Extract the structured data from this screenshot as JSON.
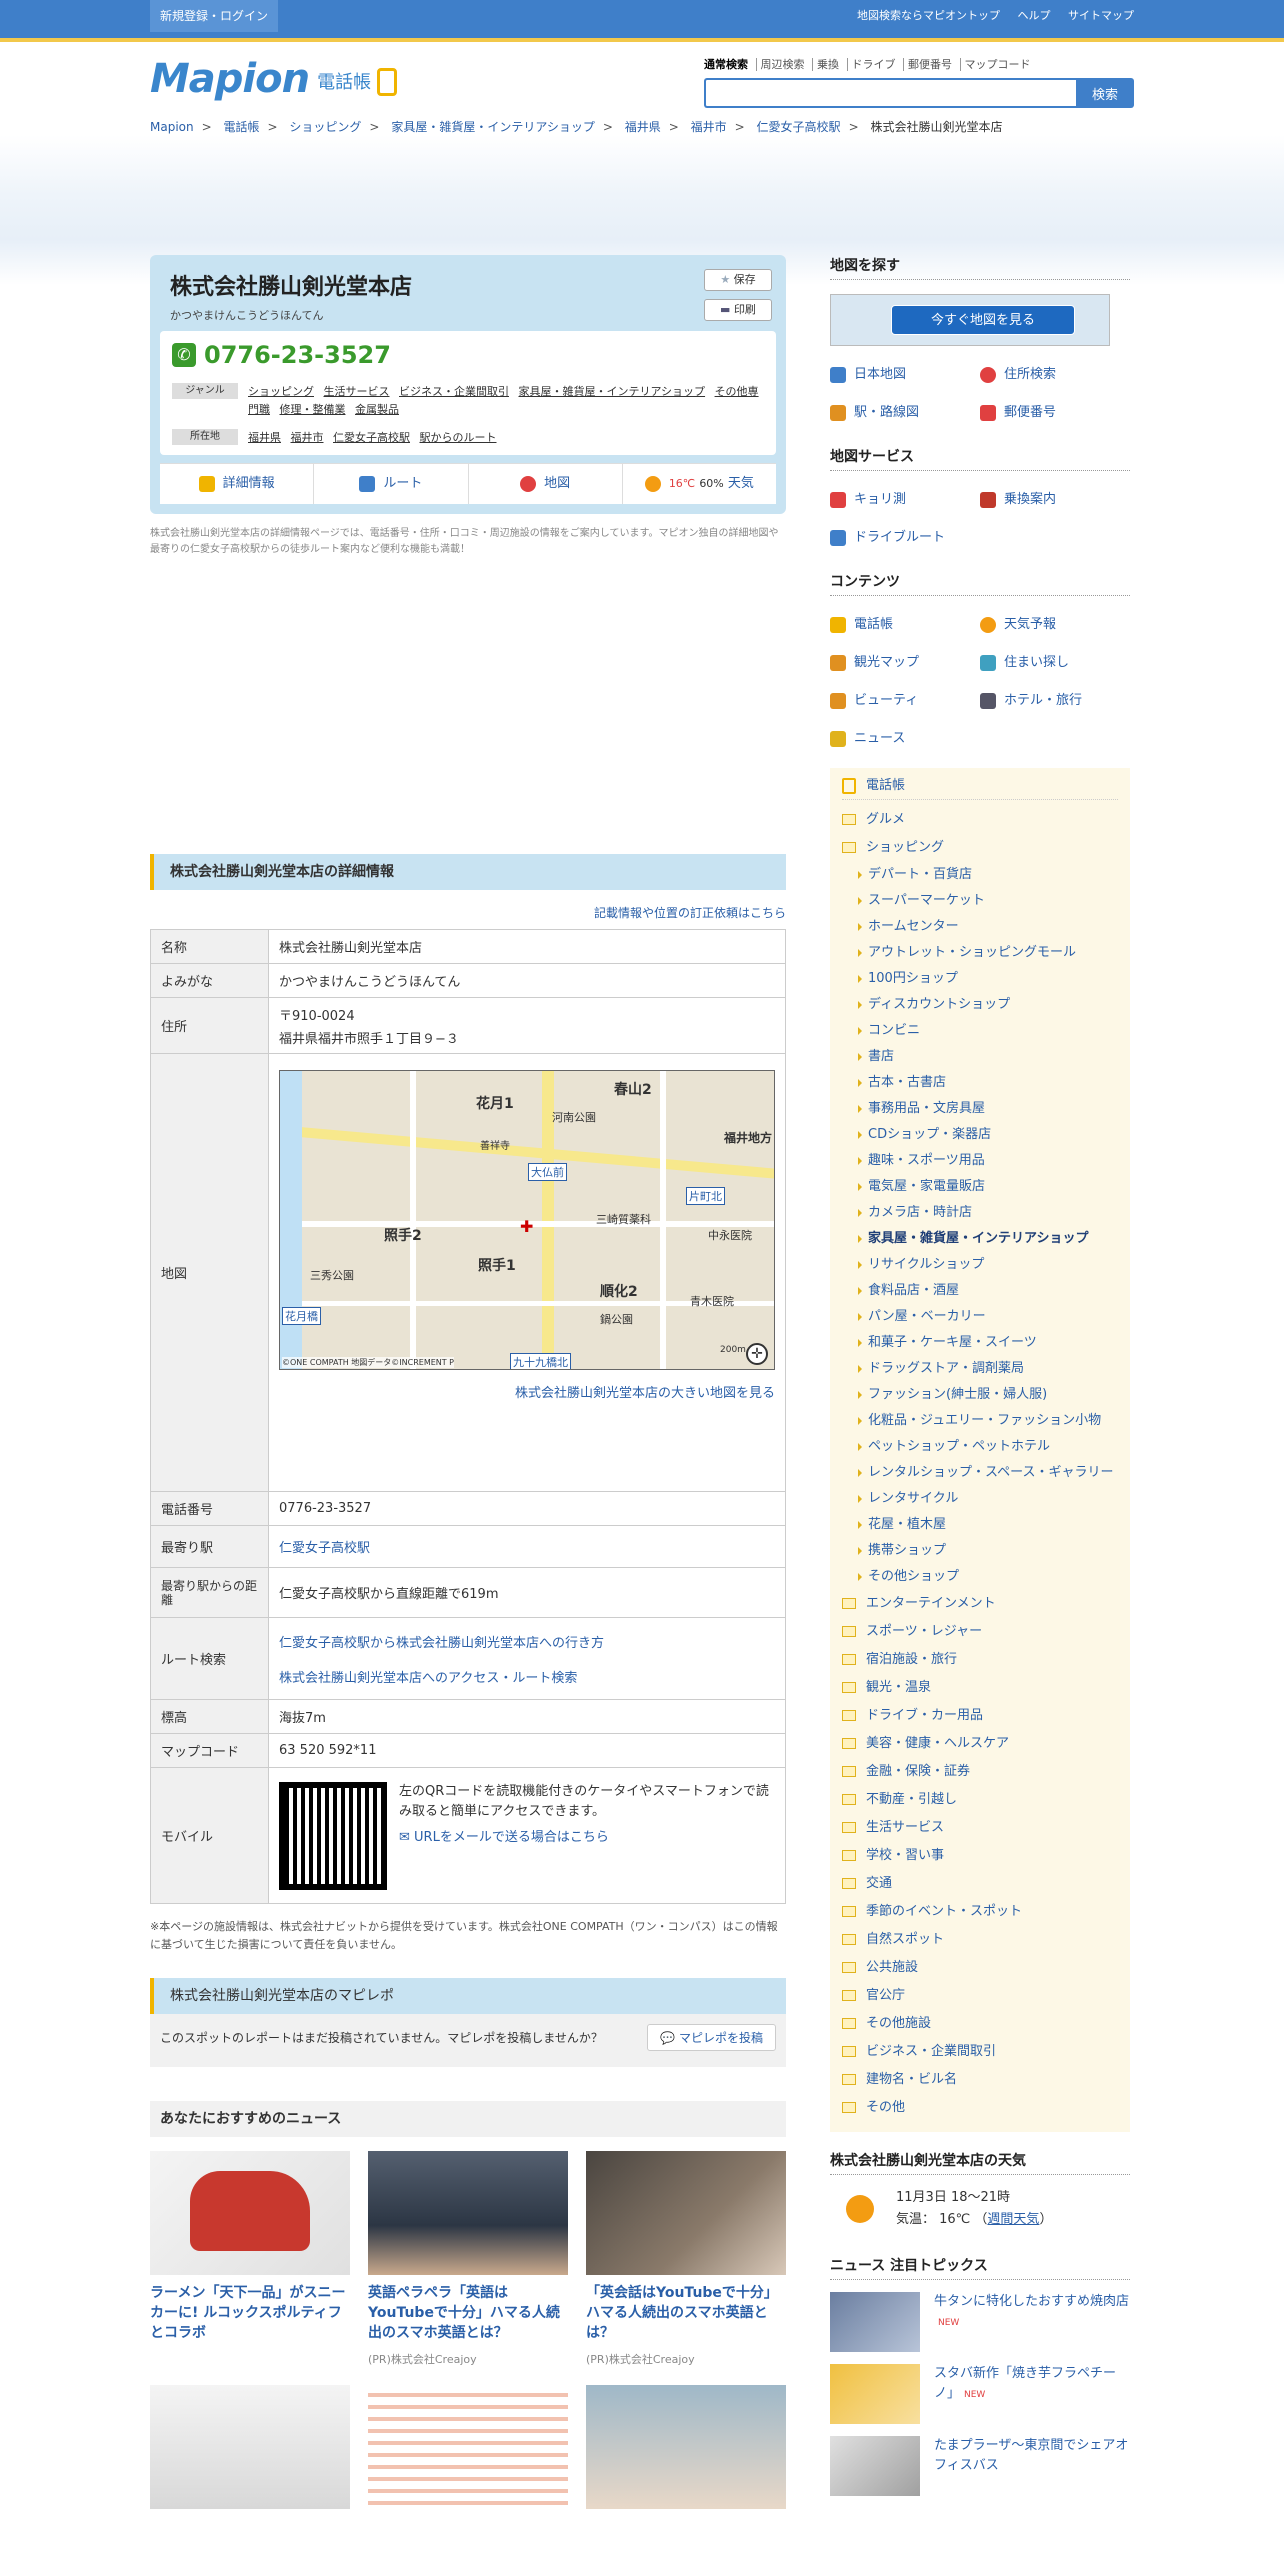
{
  "topbar": {
    "login": "新規登録・ログイン",
    "links": [
      "地図検索ならマピオントップ",
      "ヘルプ",
      "サイトマップ"
    ]
  },
  "logo": {
    "mark": "Mapion",
    "sub": "電話帳"
  },
  "search": {
    "tabs": [
      "通常検索",
      "周辺検索",
      "乗換",
      "ドライブ",
      "郵便番号",
      "マップコード"
    ],
    "button": "検索",
    "placeholder": ""
  },
  "breadcrumb": [
    "Mapion",
    "電話帳",
    "ショッピング",
    "家具屋・雑貨屋・インテリアショップ",
    "福井県",
    "福井市",
    "仁愛女子高校駅",
    "株式会社勝山剣光堂本店"
  ],
  "shop": {
    "name": "株式会社勝山剣光堂本店",
    "kana": "かつやまけんこうどうほんてん",
    "save": "保存",
    "print": "印刷",
    "tel": "0776-23-3527",
    "genre_label": "ジャンル",
    "genres": [
      "ショッピング",
      "生活サービス",
      "ビジネス・企業間取引",
      "家具屋・雑貨屋・インテリアショップ",
      "その他専門職",
      "修理・整備業",
      "金属製品"
    ],
    "loc_label": "所在地",
    "locs": [
      "福井県",
      "福井市",
      "仁愛女子高校駅",
      "駅からのルート"
    ],
    "nav": [
      "詳細情報",
      "ルート",
      "地図"
    ],
    "weather_temp": "16℃",
    "weather_pct": "60%",
    "weather_label": "天気",
    "desc": "株式会社勝山剣光堂本店の詳細情報ページでは、電話番号・住所・口コミ・周辺施設の情報をご案内しています。マピオン独自の詳細地図や最寄りの仁愛女子高校駅からの徒歩ルート案内など便利な機能も満載！"
  },
  "detail": {
    "heading": "株式会社勝山剣光堂本店の詳細情報",
    "fix_link": "記載情報や位置の訂正依頼はこちら",
    "rows": {
      "name_l": "名称",
      "name_v": "株式会社勝山剣光堂本店",
      "kana_l": "よみがな",
      "kana_v": "かつやまけんこうどうほんてん",
      "addr_l": "住所",
      "addr_zip": "〒910-0024",
      "addr_v": "福井県福井市照手１丁目９−３",
      "map_l": "地図",
      "map_link": "株式会社勝山剣光堂本店の大きい地図を見る",
      "tel_l": "電話番号",
      "tel_v": "0776-23-3527",
      "station_l": "最寄り駅",
      "station_v": "仁愛女子高校駅",
      "dist_l": "最寄り駅からの距離",
      "dist_v": "仁愛女子高校駅から直線距離で619m",
      "route_l": "ルート検索",
      "route_1": "仁愛女子高校駅から株式会社勝山剣光堂本店への行き方",
      "route_2": "株式会社勝山剣光堂本店へのアクセス・ルート検索",
      "alt_l": "標高",
      "alt_v": "海抜7m",
      "code_l": "マップコード",
      "code_v": "63 520 592*11",
      "mobile_l": "モバイル",
      "mobile_v": "左のQRコードを読取機能付きのケータイやスマートフォンで読み取ると簡単にアクセスできます。",
      "mobile_link": "URLをメールで送る場合はこちら"
    },
    "map_labels": [
      "春山2",
      "花月1",
      "河南公園",
      "福井地方",
      "大仏前",
      "片町北",
      "照手2",
      "照手1",
      "三秀公園",
      "三崎質薬科",
      "中永医院",
      "順化2",
      "青木医院",
      "鍋公園",
      "花月橋",
      "九十九橋北",
      "善祥寺",
      "200m",
      "©ONE COMPATH 地図データ©INCREMENT P"
    ],
    "note": "※本ページの施設情報は、株式会社ナビットから提供を受けています。株式会社ONE COMPATH（ワン・コンパス）はこの情報に基づいて生じた損害について責任を負いません。"
  },
  "mapirepo": {
    "heading": "株式会社勝山剣光堂本店のマピレポ",
    "text": "このスポットのレポートはまだ投稿されていません。マピレポを投稿しませんか？",
    "button": "マピレポを投稿"
  },
  "news": {
    "heading": "あなたにおすすめのニュース",
    "items": [
      {
        "title": "ラーメン「天下一品」がスニーカーに! ルコックスポルティフとコラボ",
        "pr": ""
      },
      {
        "title": "英語ペラペラ「英語はYouTubeで十分」ハマる人続出のスマホ英語とは？",
        "pr": "(PR)株式会社Creajoy"
      },
      {
        "title": "「英会話はYouTubeで十分」ハマる人続出のスマホ英語とは？",
        "pr": "(PR)株式会社Creajoy"
      }
    ]
  },
  "right": {
    "find_head": "地図を探す",
    "banner": "今すぐ地図を見る",
    "find": [
      "日本地図",
      "住所検索",
      "駅・路線図",
      "郵便番号"
    ],
    "service_head": "地図サービス",
    "service": [
      "キョリ測",
      "乗換案内",
      "ドライブルート"
    ],
    "content_head": "コンテンツ",
    "content": [
      "電話帳",
      "天気予報",
      "観光マップ",
      "住まい探し",
      "ビューティ",
      "ホテル・旅行",
      "ニュース"
    ],
    "cat_top": "電話帳",
    "cats": [
      {
        "t": "グルメ",
        "k": "f"
      },
      {
        "t": "ショッピング",
        "k": "f"
      },
      {
        "t": "デパート・百貨店",
        "k": "s"
      },
      {
        "t": "スーパーマーケット",
        "k": "s"
      },
      {
        "t": "ホームセンター",
        "k": "s"
      },
      {
        "t": "アウトレット・ショッピングモール",
        "k": "s"
      },
      {
        "t": "100円ショップ",
        "k": "s"
      },
      {
        "t": "ディスカウントショップ",
        "k": "s"
      },
      {
        "t": "コンビニ",
        "k": "s"
      },
      {
        "t": "書店",
        "k": "s"
      },
      {
        "t": "古本・古書店",
        "k": "s"
      },
      {
        "t": "事務用品・文房具屋",
        "k": "s"
      },
      {
        "t": "CDショップ・楽器店",
        "k": "s"
      },
      {
        "t": "趣味・スポーツ用品",
        "k": "s"
      },
      {
        "t": "電気屋・家電量販店",
        "k": "s"
      },
      {
        "t": "カメラ店・時計店",
        "k": "s"
      },
      {
        "t": "家具屋・雑貨屋・インテリアショップ",
        "k": "b"
      },
      {
        "t": "リサイクルショップ",
        "k": "s"
      },
      {
        "t": "食料品店・酒屋",
        "k": "s"
      },
      {
        "t": "パン屋・ベーカリー",
        "k": "s"
      },
      {
        "t": "和菓子・ケーキ屋・スイーツ",
        "k": "s"
      },
      {
        "t": "ドラッグストア・調剤薬局",
        "k": "s"
      },
      {
        "t": "ファッション(紳士服・婦人服)",
        "k": "s"
      },
      {
        "t": "化粧品・ジュエリー・ファッション小物",
        "k": "s"
      },
      {
        "t": "ペットショップ・ペットホテル",
        "k": "s"
      },
      {
        "t": "レンタルショップ・スペース・ギャラリー",
        "k": "s"
      },
      {
        "t": "レンタサイクル",
        "k": "s"
      },
      {
        "t": "花屋・植木屋",
        "k": "s"
      },
      {
        "t": "携帯ショップ",
        "k": "s"
      },
      {
        "t": "その他ショップ",
        "k": "s"
      },
      {
        "t": "エンターテインメント",
        "k": "f"
      },
      {
        "t": "スポーツ・レジャー",
        "k": "f"
      },
      {
        "t": "宿泊施設・旅行",
        "k": "f"
      },
      {
        "t": "観光・温泉",
        "k": "f"
      },
      {
        "t": "ドライブ・カー用品",
        "k": "f"
      },
      {
        "t": "美容・健康・ヘルスケア",
        "k": "f"
      },
      {
        "t": "金融・保険・証券",
        "k": "f"
      },
      {
        "t": "不動産・引越し",
        "k": "f"
      },
      {
        "t": "生活サービス",
        "k": "f"
      },
      {
        "t": "学校・習い事",
        "k": "f"
      },
      {
        "t": "交通",
        "k": "f"
      },
      {
        "t": "季節のイベント・スポット",
        "k": "f"
      },
      {
        "t": "自然スポット",
        "k": "f"
      },
      {
        "t": "公共施設",
        "k": "f"
      },
      {
        "t": "官公庁",
        "k": "f"
      },
      {
        "t": "その他施設",
        "k": "f"
      },
      {
        "t": "ビジネス・企業間取引",
        "k": "f"
      },
      {
        "t": "建物名・ビル名",
        "k": "f"
      },
      {
        "t": "その他",
        "k": "f"
      }
    ],
    "weather_head": "株式会社勝山剣光堂本店の天気",
    "weather_date": "11月3日 18～21時",
    "weather_temp": "気温： 16℃",
    "weather_week": "週間天気",
    "topics_head": "ニュース 注目トピックス",
    "topics": [
      {
        "t": "牛タンに特化したおすすめ焼肉店",
        "new": "NEW"
      },
      {
        "t": "スタバ新作「焼き芋フラペチーノ」",
        "new": "NEW"
      },
      {
        "t": "たまプラーザ〜東京間でシェアオフィスバス",
        "new": ""
      }
    ]
  }
}
